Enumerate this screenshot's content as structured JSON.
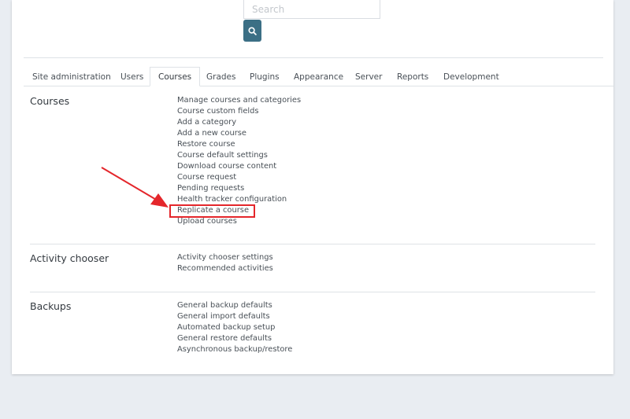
{
  "search": {
    "placeholder": "Search"
  },
  "tabs": [
    {
      "label": "Site administration",
      "active": false
    },
    {
      "label": "Users",
      "active": false
    },
    {
      "label": "Courses",
      "active": true
    },
    {
      "label": "Grades",
      "active": false
    },
    {
      "label": "Plugins",
      "active": false
    },
    {
      "label": "Appearance",
      "active": false
    },
    {
      "label": "Server",
      "active": false
    },
    {
      "label": "Reports",
      "active": false
    },
    {
      "label": "Development",
      "active": false
    }
  ],
  "sections": [
    {
      "title": "Courses",
      "links": [
        "Manage courses and categories",
        "Course custom fields",
        "Add a category",
        "Add a new course",
        "Restore course",
        "Course default settings",
        "Download course content",
        "Course request",
        "Pending requests",
        "Health tracker configuration",
        "Replicate a course",
        "Upload courses"
      ]
    },
    {
      "title": "Activity chooser",
      "links": [
        "Activity chooser settings",
        "Recommended activities"
      ]
    },
    {
      "title": "Backups",
      "links": [
        "General backup defaults",
        "General import defaults",
        "Automated backup setup",
        "General restore defaults",
        "Asynchronous backup/restore"
      ]
    }
  ],
  "annotation": {
    "highlighted_link": "Replicate a course",
    "color": "#e4262b"
  },
  "colors": {
    "accent": "#3b6f85",
    "text": "#495057",
    "background": "#e9edf2"
  }
}
